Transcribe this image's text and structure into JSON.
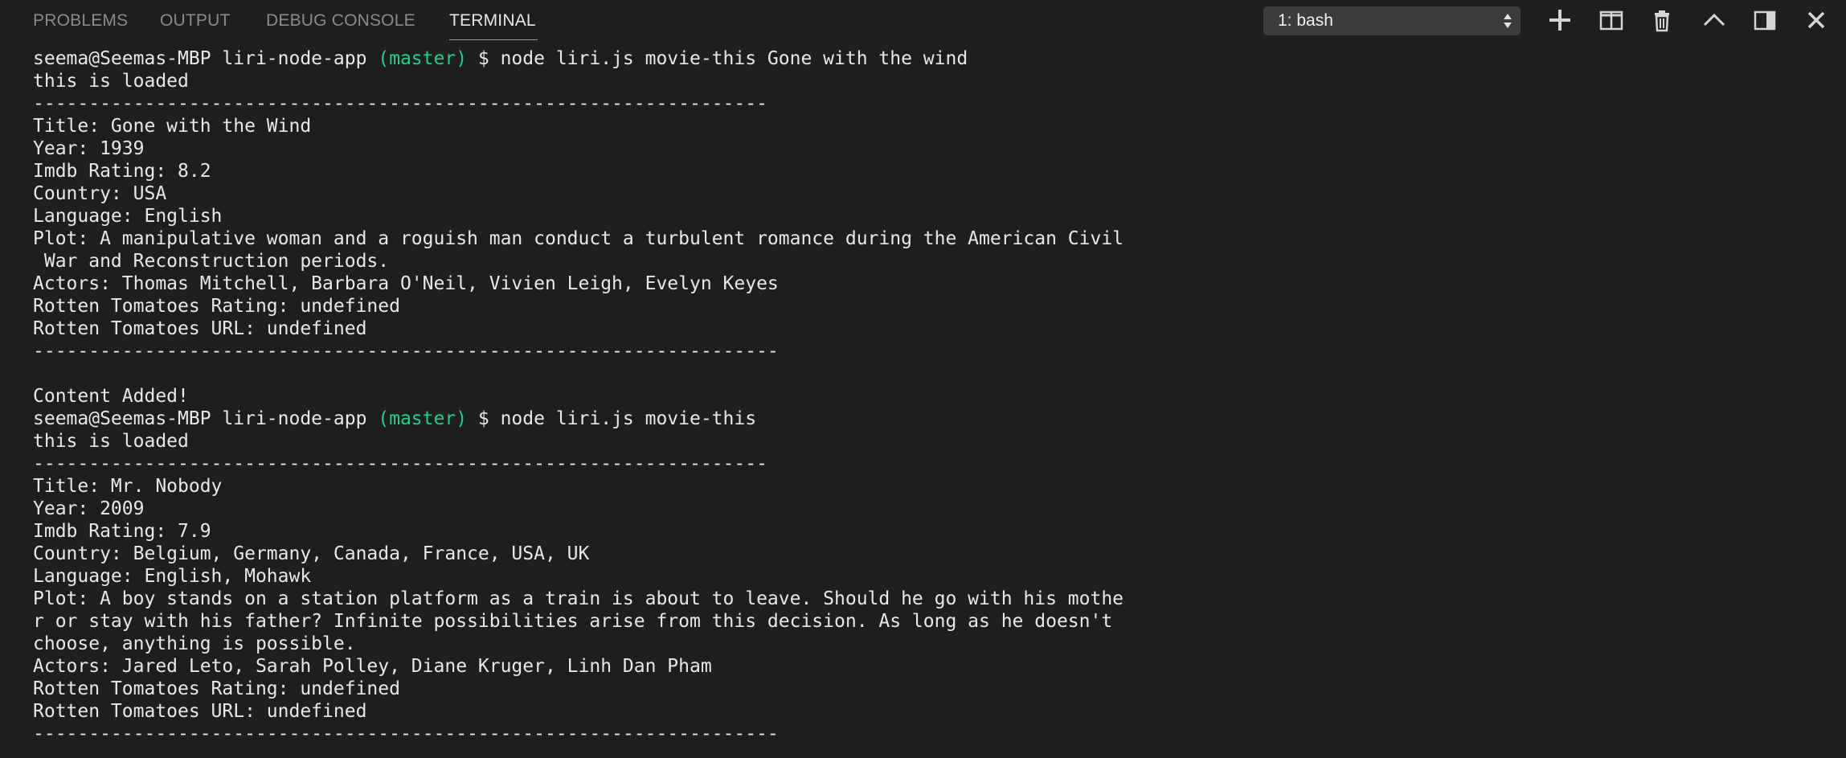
{
  "tabs": [
    {
      "label": "PROBLEMS",
      "active": false
    },
    {
      "label": "OUTPUT",
      "active": false
    },
    {
      "label": "DEBUG CONSOLE",
      "active": false
    },
    {
      "label": "TERMINAL",
      "active": true
    }
  ],
  "terminal_selector": {
    "value": "1: bash"
  },
  "actions": [
    {
      "name": "new-terminal",
      "icon": "plus-icon"
    },
    {
      "name": "split-terminal",
      "icon": "split-icon"
    },
    {
      "name": "kill-terminal",
      "icon": "trash-icon"
    },
    {
      "name": "maximize-panel",
      "icon": "chevron-up-icon"
    },
    {
      "name": "toggle-panel-position",
      "icon": "panel-right-icon"
    },
    {
      "name": "close-panel",
      "icon": "close-icon"
    }
  ],
  "colors": {
    "background": "#1e1e1e",
    "text": "#e8e8e8",
    "branch": "#23d18b",
    "tab_inactive": "#8b8b8b",
    "tab_active": "#e7e7e7"
  },
  "terminal": {
    "lines": [
      {
        "parts": [
          {
            "t": "seema@Seemas-MBP liri-node-app "
          },
          {
            "t": "(master)",
            "c": "branch"
          },
          {
            "t": " $ node liri.js movie-this Gone with the wind"
          }
        ]
      },
      {
        "parts": [
          {
            "t": "this is loaded"
          }
        ]
      },
      {
        "parts": [
          {
            "t": "------------------------------------------------------------------"
          }
        ]
      },
      {
        "parts": [
          {
            "t": "Title: Gone with the Wind"
          }
        ]
      },
      {
        "parts": [
          {
            "t": "Year: 1939"
          }
        ]
      },
      {
        "parts": [
          {
            "t": "Imdb Rating: 8.2"
          }
        ]
      },
      {
        "parts": [
          {
            "t": "Country: USA"
          }
        ]
      },
      {
        "parts": [
          {
            "t": "Language: English"
          }
        ]
      },
      {
        "parts": [
          {
            "t": "Plot: A manipulative woman and a roguish man conduct a turbulent romance during the American Civil"
          }
        ]
      },
      {
        "parts": [
          {
            "t": " War and Reconstruction periods."
          }
        ]
      },
      {
        "parts": [
          {
            "t": "Actors: Thomas Mitchell, Barbara O'Neil, Vivien Leigh, Evelyn Keyes"
          }
        ]
      },
      {
        "parts": [
          {
            "t": "Rotten Tomatoes Rating: undefined"
          }
        ]
      },
      {
        "parts": [
          {
            "t": "Rotten Tomatoes URL: undefined"
          }
        ]
      },
      {
        "parts": [
          {
            "t": "-------------------------------------------------------------------"
          }
        ]
      },
      {
        "parts": [
          {
            "t": ""
          }
        ]
      },
      {
        "parts": [
          {
            "t": "Content Added!"
          }
        ]
      },
      {
        "parts": [
          {
            "t": "seema@Seemas-MBP liri-node-app "
          },
          {
            "t": "(master)",
            "c": "branch"
          },
          {
            "t": " $ node liri.js movie-this"
          }
        ]
      },
      {
        "parts": [
          {
            "t": "this is loaded"
          }
        ]
      },
      {
        "parts": [
          {
            "t": "------------------------------------------------------------------"
          }
        ]
      },
      {
        "parts": [
          {
            "t": "Title: Mr. Nobody"
          }
        ]
      },
      {
        "parts": [
          {
            "t": "Year: 2009"
          }
        ]
      },
      {
        "parts": [
          {
            "t": "Imdb Rating: 7.9"
          }
        ]
      },
      {
        "parts": [
          {
            "t": "Country: Belgium, Germany, Canada, France, USA, UK"
          }
        ]
      },
      {
        "parts": [
          {
            "t": "Language: English, Mohawk"
          }
        ]
      },
      {
        "parts": [
          {
            "t": "Plot: A boy stands on a station platform as a train is about to leave. Should he go with his mothe"
          }
        ]
      },
      {
        "parts": [
          {
            "t": "r or stay with his father? Infinite possibilities arise from this decision. As long as he doesn't"
          }
        ]
      },
      {
        "parts": [
          {
            "t": "choose, anything is possible."
          }
        ]
      },
      {
        "parts": [
          {
            "t": "Actors: Jared Leto, Sarah Polley, Diane Kruger, Linh Dan Pham"
          }
        ]
      },
      {
        "parts": [
          {
            "t": "Rotten Tomatoes Rating: undefined"
          }
        ]
      },
      {
        "parts": [
          {
            "t": "Rotten Tomatoes URL: undefined"
          }
        ]
      },
      {
        "parts": [
          {
            "t": "-------------------------------------------------------------------"
          }
        ]
      }
    ]
  }
}
